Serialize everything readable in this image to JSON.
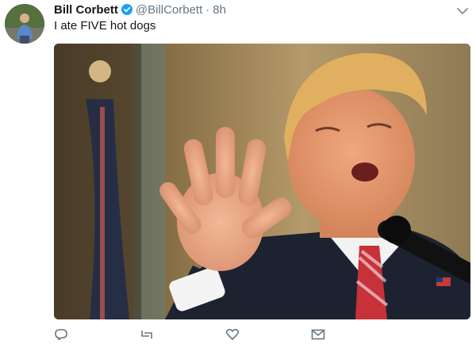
{
  "tweet": {
    "author_name": "Bill Corbett",
    "handle": "@BillCorbett",
    "separator": "·",
    "time": "8h",
    "text": "I ate FIVE hot dogs",
    "media_description": "photo"
  },
  "icons": {
    "verified": "verified-badge-icon",
    "menu": "chevron-down-icon",
    "reply": "reply-icon",
    "retweet": "retweet-icon",
    "like": "like-icon",
    "message": "direct-message-icon"
  },
  "colors": {
    "verified_blue": "#1da1f2",
    "secondary_text": "#657786",
    "primary_text": "#14171a"
  }
}
